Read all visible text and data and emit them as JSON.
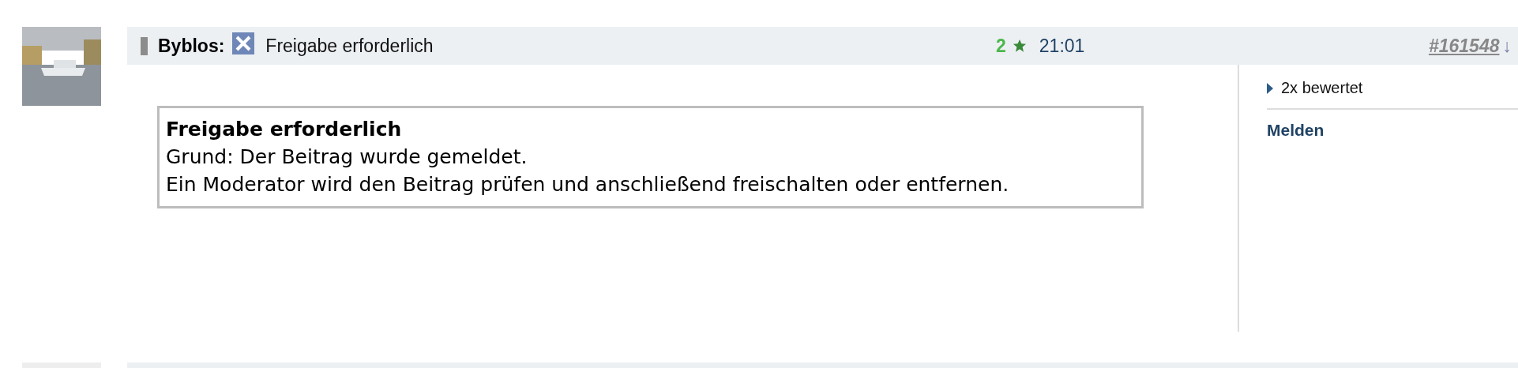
{
  "post": {
    "author": "Byblos:",
    "title": "Freigabe erforderlich",
    "score": "2",
    "time": "21:01",
    "number": "#161548",
    "arrow": "↓"
  },
  "notice": {
    "title": "Freigabe erforderlich",
    "lines": [
      "Grund: Der Beitrag wurde gemeldet.",
      "Ein Moderator wird den Beitrag prüfen und anschließend freischalten oder entfernen."
    ]
  },
  "sidebar": {
    "ratings": {
      "label": "2x bewertet",
      "expanded": false
    },
    "report_link": "Melden"
  }
}
